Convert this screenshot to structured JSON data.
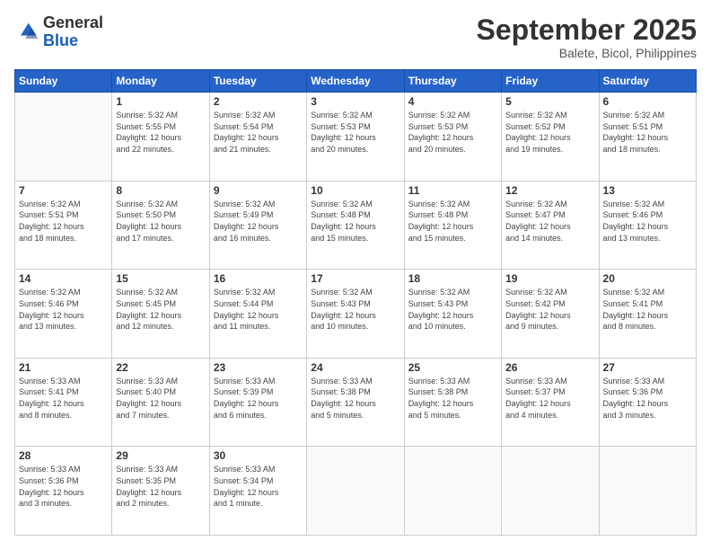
{
  "header": {
    "logo_general": "General",
    "logo_blue": "Blue",
    "month_title": "September 2025",
    "location": "Balete, Bicol, Philippines"
  },
  "weekdays": [
    "Sunday",
    "Monday",
    "Tuesday",
    "Wednesday",
    "Thursday",
    "Friday",
    "Saturday"
  ],
  "weeks": [
    [
      {
        "day": "",
        "info": ""
      },
      {
        "day": "1",
        "info": "Sunrise: 5:32 AM\nSunset: 5:55 PM\nDaylight: 12 hours\nand 22 minutes."
      },
      {
        "day": "2",
        "info": "Sunrise: 5:32 AM\nSunset: 5:54 PM\nDaylight: 12 hours\nand 21 minutes."
      },
      {
        "day": "3",
        "info": "Sunrise: 5:32 AM\nSunset: 5:53 PM\nDaylight: 12 hours\nand 20 minutes."
      },
      {
        "day": "4",
        "info": "Sunrise: 5:32 AM\nSunset: 5:53 PM\nDaylight: 12 hours\nand 20 minutes."
      },
      {
        "day": "5",
        "info": "Sunrise: 5:32 AM\nSunset: 5:52 PM\nDaylight: 12 hours\nand 19 minutes."
      },
      {
        "day": "6",
        "info": "Sunrise: 5:32 AM\nSunset: 5:51 PM\nDaylight: 12 hours\nand 18 minutes."
      }
    ],
    [
      {
        "day": "7",
        "info": "Sunrise: 5:32 AM\nSunset: 5:51 PM\nDaylight: 12 hours\nand 18 minutes."
      },
      {
        "day": "8",
        "info": "Sunrise: 5:32 AM\nSunset: 5:50 PM\nDaylight: 12 hours\nand 17 minutes."
      },
      {
        "day": "9",
        "info": "Sunrise: 5:32 AM\nSunset: 5:49 PM\nDaylight: 12 hours\nand 16 minutes."
      },
      {
        "day": "10",
        "info": "Sunrise: 5:32 AM\nSunset: 5:48 PM\nDaylight: 12 hours\nand 15 minutes."
      },
      {
        "day": "11",
        "info": "Sunrise: 5:32 AM\nSunset: 5:48 PM\nDaylight: 12 hours\nand 15 minutes."
      },
      {
        "day": "12",
        "info": "Sunrise: 5:32 AM\nSunset: 5:47 PM\nDaylight: 12 hours\nand 14 minutes."
      },
      {
        "day": "13",
        "info": "Sunrise: 5:32 AM\nSunset: 5:46 PM\nDaylight: 12 hours\nand 13 minutes."
      }
    ],
    [
      {
        "day": "14",
        "info": "Sunrise: 5:32 AM\nSunset: 5:46 PM\nDaylight: 12 hours\nand 13 minutes."
      },
      {
        "day": "15",
        "info": "Sunrise: 5:32 AM\nSunset: 5:45 PM\nDaylight: 12 hours\nand 12 minutes."
      },
      {
        "day": "16",
        "info": "Sunrise: 5:32 AM\nSunset: 5:44 PM\nDaylight: 12 hours\nand 11 minutes."
      },
      {
        "day": "17",
        "info": "Sunrise: 5:32 AM\nSunset: 5:43 PM\nDaylight: 12 hours\nand 10 minutes."
      },
      {
        "day": "18",
        "info": "Sunrise: 5:32 AM\nSunset: 5:43 PM\nDaylight: 12 hours\nand 10 minutes."
      },
      {
        "day": "19",
        "info": "Sunrise: 5:32 AM\nSunset: 5:42 PM\nDaylight: 12 hours\nand 9 minutes."
      },
      {
        "day": "20",
        "info": "Sunrise: 5:32 AM\nSunset: 5:41 PM\nDaylight: 12 hours\nand 8 minutes."
      }
    ],
    [
      {
        "day": "21",
        "info": "Sunrise: 5:33 AM\nSunset: 5:41 PM\nDaylight: 12 hours\nand 8 minutes."
      },
      {
        "day": "22",
        "info": "Sunrise: 5:33 AM\nSunset: 5:40 PM\nDaylight: 12 hours\nand 7 minutes."
      },
      {
        "day": "23",
        "info": "Sunrise: 5:33 AM\nSunset: 5:39 PM\nDaylight: 12 hours\nand 6 minutes."
      },
      {
        "day": "24",
        "info": "Sunrise: 5:33 AM\nSunset: 5:38 PM\nDaylight: 12 hours\nand 5 minutes."
      },
      {
        "day": "25",
        "info": "Sunrise: 5:33 AM\nSunset: 5:38 PM\nDaylight: 12 hours\nand 5 minutes."
      },
      {
        "day": "26",
        "info": "Sunrise: 5:33 AM\nSunset: 5:37 PM\nDaylight: 12 hours\nand 4 minutes."
      },
      {
        "day": "27",
        "info": "Sunrise: 5:33 AM\nSunset: 5:36 PM\nDaylight: 12 hours\nand 3 minutes."
      }
    ],
    [
      {
        "day": "28",
        "info": "Sunrise: 5:33 AM\nSunset: 5:36 PM\nDaylight: 12 hours\nand 3 minutes."
      },
      {
        "day": "29",
        "info": "Sunrise: 5:33 AM\nSunset: 5:35 PM\nDaylight: 12 hours\nand 2 minutes."
      },
      {
        "day": "30",
        "info": "Sunrise: 5:33 AM\nSunset: 5:34 PM\nDaylight: 12 hours\nand 1 minute."
      },
      {
        "day": "",
        "info": ""
      },
      {
        "day": "",
        "info": ""
      },
      {
        "day": "",
        "info": ""
      },
      {
        "day": "",
        "info": ""
      }
    ]
  ]
}
